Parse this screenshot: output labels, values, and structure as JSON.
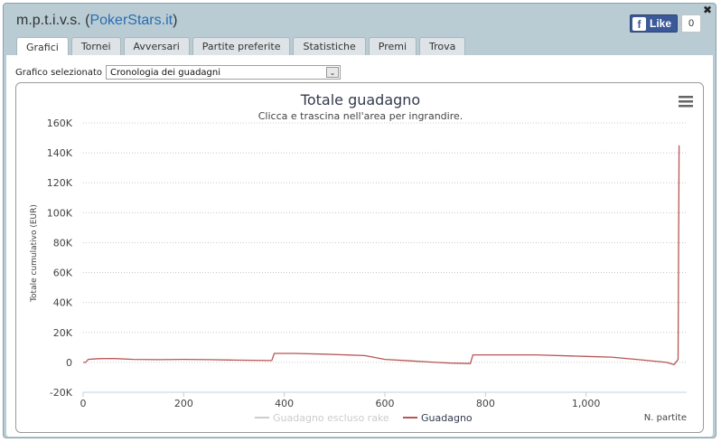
{
  "window": {
    "title_user": "m.p.t.i.v.s. (",
    "title_site": "PokerStars.it",
    "title_close": ")",
    "close_glyph": "✖"
  },
  "facebook": {
    "like_label": "Like",
    "count": "0",
    "brand_color": "#3b5998"
  },
  "tabs": [
    {
      "label": "Grafici",
      "active": true
    },
    {
      "label": "Tornei",
      "active": false
    },
    {
      "label": "Avversari",
      "active": false
    },
    {
      "label": "Partite preferite",
      "active": false
    },
    {
      "label": "Statistiche",
      "active": false
    },
    {
      "label": "Premi",
      "active": false
    },
    {
      "label": "Trova",
      "active": false
    }
  ],
  "selector": {
    "label": "Grafico selezionato",
    "value": "Cronologia dei guadagni"
  },
  "chart_data": {
    "type": "line",
    "title": "Totale guadagno",
    "subtitle": "Clicca e trascina nell'area per ingrandire.",
    "xlabel": "N. partite",
    "ylabel": "Totale cumulativo (EUR)",
    "xlim": [
      0,
      1200
    ],
    "ylim": [
      -20000,
      160000
    ],
    "x_ticks": [
      0,
      200,
      400,
      600,
      800,
      1000
    ],
    "x_tick_labels": [
      "0",
      "200",
      "400",
      "600",
      "800",
      "1,000"
    ],
    "y_ticks": [
      -20000,
      0,
      20000,
      40000,
      60000,
      80000,
      100000,
      120000,
      140000,
      160000
    ],
    "y_tick_labels": [
      "-20K",
      "0",
      "20K",
      "40K",
      "60K",
      "80K",
      "100K",
      "120K",
      "140K",
      "160K"
    ],
    "grid": true,
    "legend_position": "bottom",
    "series": [
      {
        "name": "Guadagno escluso rake",
        "color": "#c8c8c8",
        "visible": false,
        "points": []
      },
      {
        "name": "Guadagno",
        "color": "#b85555",
        "visible": true,
        "points": [
          [
            0,
            0
          ],
          [
            5,
            0
          ],
          [
            10,
            2000
          ],
          [
            30,
            2500
          ],
          [
            60,
            2600
          ],
          [
            100,
            2000
          ],
          [
            150,
            1800
          ],
          [
            200,
            2000
          ],
          [
            250,
            1800
          ],
          [
            300,
            1500
          ],
          [
            375,
            1200
          ],
          [
            380,
            6000
          ],
          [
            420,
            6000
          ],
          [
            480,
            5500
          ],
          [
            560,
            4500
          ],
          [
            600,
            2000
          ],
          [
            650,
            1000
          ],
          [
            700,
            0
          ],
          [
            730,
            -500
          ],
          [
            770,
            -800
          ],
          [
            775,
            5000
          ],
          [
            820,
            5000
          ],
          [
            900,
            5000
          ],
          [
            1000,
            4000
          ],
          [
            1050,
            3500
          ],
          [
            1100,
            2000
          ],
          [
            1160,
            0
          ],
          [
            1175,
            -1500
          ],
          [
            1183,
            2000
          ],
          [
            1185,
            145000
          ]
        ]
      }
    ]
  }
}
